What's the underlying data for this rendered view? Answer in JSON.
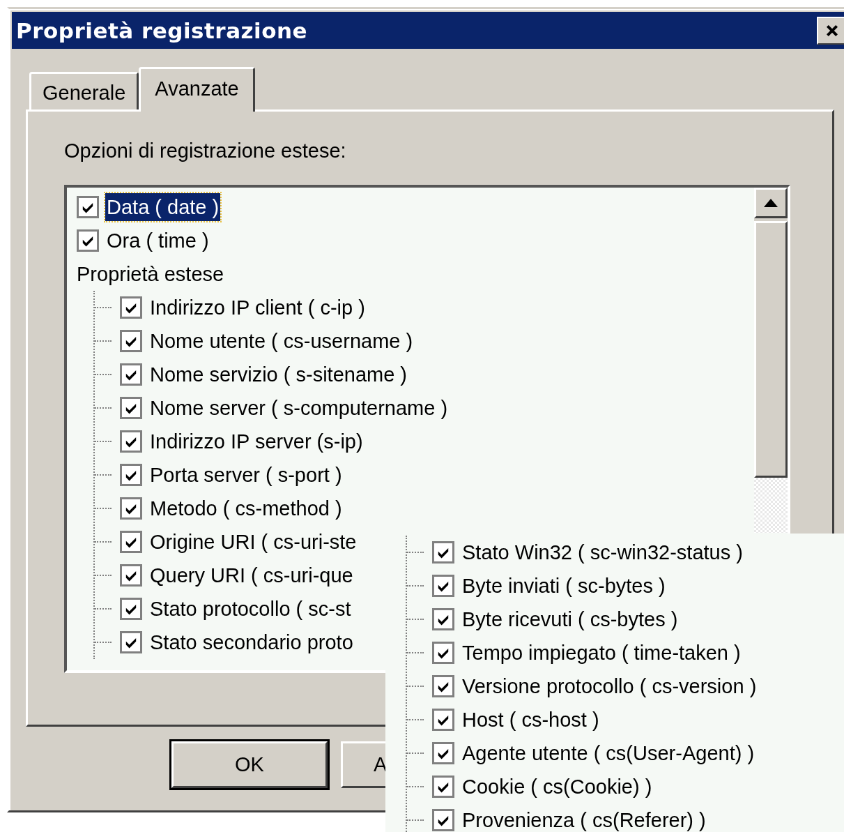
{
  "window": {
    "title": "Proprietà registrazione"
  },
  "tabs": [
    {
      "label": "Generale",
      "selected": false
    },
    {
      "label": "Avanzate",
      "selected": true
    }
  ],
  "options_label": "Opzioni di registrazione estese:",
  "list": {
    "items": [
      {
        "kind": "check",
        "label": "Data  ( date )",
        "checked": true,
        "selected": true
      },
      {
        "kind": "check",
        "label": "Ora  ( time )",
        "checked": true,
        "selected": false
      },
      {
        "kind": "group",
        "label": "Proprietà estese",
        "children": [
          {
            "label": "Indirizzo IP client ( c-ip )",
            "checked": true
          },
          {
            "label": "Nome utente ( cs-username )",
            "checked": true
          },
          {
            "label": "Nome servizio ( s-sitename )",
            "checked": true
          },
          {
            "label": "Nome server ( s-computername )",
            "checked": true
          },
          {
            "label": "Indirizzo IP server (s-ip)",
            "checked": true
          },
          {
            "label": "Porta server ( s-port )",
            "checked": true
          },
          {
            "label": "Metodo  ( cs-method )",
            "checked": true
          },
          {
            "label": "Origine URI ( cs-uri-ste",
            "checked": true
          },
          {
            "label": "Query URI ( cs-uri-que",
            "checked": true
          },
          {
            "label": "Stato protocollo ( sc-st",
            "checked": true
          },
          {
            "label": "Stato secondario proto",
            "checked": true
          }
        ]
      }
    ]
  },
  "buttons": [
    {
      "label": "OK",
      "default": true
    },
    {
      "label": "A",
      "default": false
    }
  ],
  "zoom_panel": {
    "items": [
      {
        "label": "Stato Win32 ( sc-win32-status )",
        "checked": true
      },
      {
        "label": "Byte inviati  ( sc-bytes )",
        "checked": true
      },
      {
        "label": "Byte ricevuti  ( cs-bytes )",
        "checked": true
      },
      {
        "label": "Tempo impiegato ( time-taken )",
        "checked": true
      },
      {
        "label": "Versione protocollo  ( cs-version )",
        "checked": true
      },
      {
        "label": "Host  ( cs-host )",
        "checked": true
      },
      {
        "label": "Agente utente ( cs(User-Agent) )",
        "checked": true
      },
      {
        "label": "Cookie  ( cs(Cookie) )",
        "checked": true
      },
      {
        "label": "Provenienza ( cs(Referer) )",
        "checked": true
      }
    ]
  }
}
